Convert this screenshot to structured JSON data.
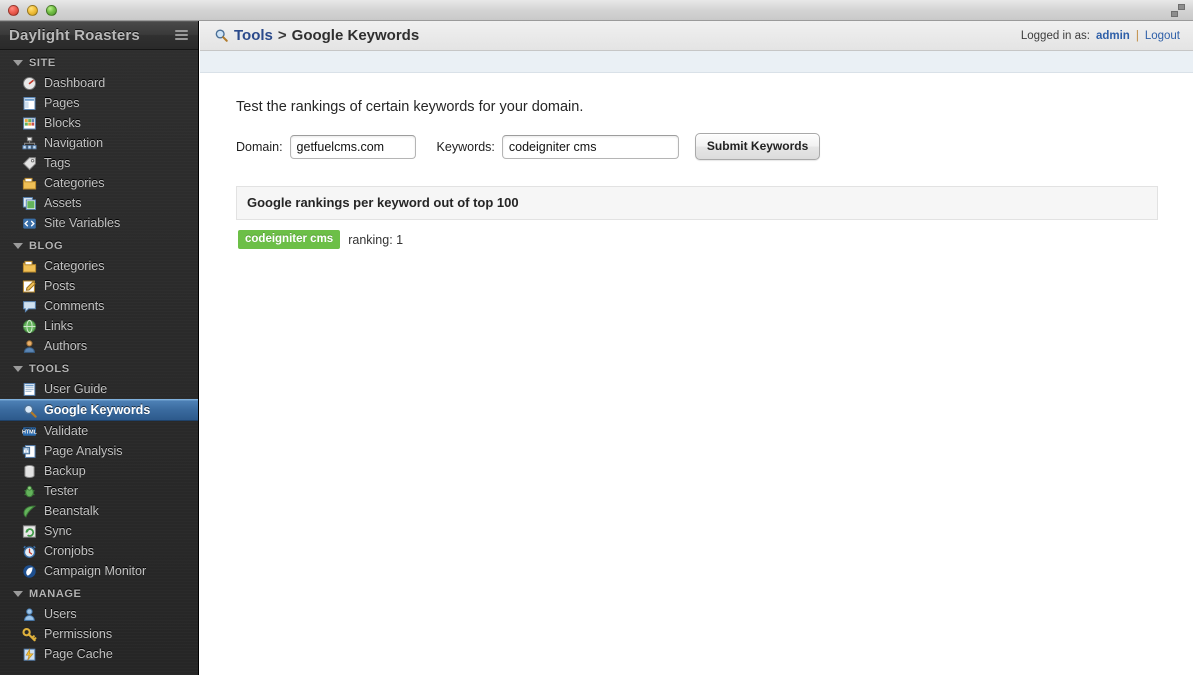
{
  "window": {
    "controls": [
      "close",
      "minimize",
      "maximize"
    ],
    "resize_icon": "resize-icon"
  },
  "sidebar": {
    "brand": "Daylight Roasters",
    "menu_icon": "hamburger-icon",
    "sections": [
      {
        "title": "SITE",
        "items": [
          {
            "label": "Dashboard",
            "icon": "gauge-icon",
            "active": false
          },
          {
            "label": "Pages",
            "icon": "page-icon",
            "active": false
          },
          {
            "label": "Blocks",
            "icon": "blocks-icon",
            "active": false
          },
          {
            "label": "Navigation",
            "icon": "sitemap-icon",
            "active": false
          },
          {
            "label": "Tags",
            "icon": "tag-icon",
            "active": false
          },
          {
            "label": "Categories",
            "icon": "folder-icon",
            "active": false
          },
          {
            "label": "Assets",
            "icon": "images-icon",
            "active": false
          },
          {
            "label": "Site Variables",
            "icon": "code-icon",
            "active": false
          }
        ]
      },
      {
        "title": "BLOG",
        "items": [
          {
            "label": "Categories",
            "icon": "folder-icon",
            "active": false
          },
          {
            "label": "Posts",
            "icon": "pencil-icon",
            "active": false
          },
          {
            "label": "Comments",
            "icon": "comment-icon",
            "active": false
          },
          {
            "label": "Links",
            "icon": "globe-icon",
            "active": false
          },
          {
            "label": "Authors",
            "icon": "person-icon",
            "active": false
          }
        ]
      },
      {
        "title": "TOOLS",
        "items": [
          {
            "label": "User Guide",
            "icon": "book-icon",
            "active": false
          },
          {
            "label": "Google Keywords",
            "icon": "search-icon",
            "active": true
          },
          {
            "label": "Validate",
            "icon": "html-icon",
            "active": false
          },
          {
            "label": "Page Analysis",
            "icon": "analysis-icon",
            "active": false
          },
          {
            "label": "Backup",
            "icon": "database-icon",
            "active": false
          },
          {
            "label": "Tester",
            "icon": "bug-icon",
            "active": false
          },
          {
            "label": "Beanstalk",
            "icon": "leaf-icon",
            "active": false
          },
          {
            "label": "Sync",
            "icon": "sync-icon",
            "active": false
          },
          {
            "label": "Cronjobs",
            "icon": "clock-icon",
            "active": false
          },
          {
            "label": "Campaign Monitor",
            "icon": "campaign-icon",
            "active": false
          }
        ]
      },
      {
        "title": "MANAGE",
        "items": [
          {
            "label": "Users",
            "icon": "user-icon",
            "active": false
          },
          {
            "label": "Permissions",
            "icon": "key-icon",
            "active": false
          },
          {
            "label": "Page Cache",
            "icon": "cache-icon",
            "active": false
          }
        ]
      }
    ]
  },
  "header": {
    "breadcrumb_section": "Tools",
    "breadcrumb_separator": ">",
    "breadcrumb_page": "Google Keywords",
    "breadcrumb_icon": "search-icon",
    "logged_in_label": "Logged in as:",
    "username": "admin",
    "divider": "|",
    "logout_label": "Logout"
  },
  "main": {
    "lead": "Test the rankings of certain keywords for your domain.",
    "form": {
      "domain_label": "Domain:",
      "domain_value": "getfuelcms.com",
      "keywords_label": "Keywords:",
      "keywords_value": "codeigniter cms",
      "submit_label": "Submit Keywords"
    },
    "results": {
      "heading": "Google rankings per keyword out of top 100",
      "rows": [
        {
          "keyword": "codeigniter cms",
          "ranking_text": "ranking: 1"
        }
      ]
    }
  },
  "colors": {
    "accent_blue": "#2e5fa8",
    "badge_green": "#6cbf47",
    "sidebar_bg": "#2b2b2b",
    "active_item": "#3a6a9e"
  }
}
